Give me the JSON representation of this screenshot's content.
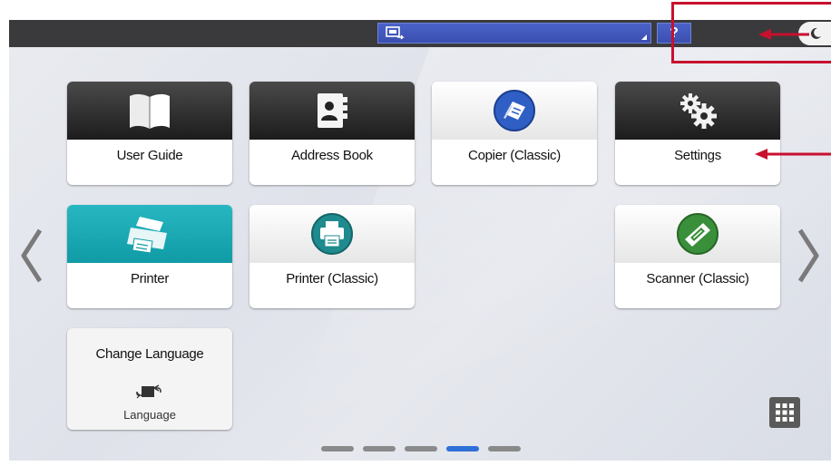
{
  "top_bar": {
    "help_label": "?"
  },
  "tiles": [
    {
      "label": "User Guide",
      "icon": "book-icon"
    },
    {
      "label": "Address Book",
      "icon": "address-book-icon"
    },
    {
      "label": "Copier (Classic)",
      "icon": "copier-icon"
    },
    {
      "label": "Settings",
      "icon": "gears-icon"
    },
    {
      "label": "Printer",
      "icon": "printer-icon"
    },
    {
      "label": "Printer (Classic)",
      "icon": "printer-classic-icon"
    },
    {
      "label": "Scanner (Classic)",
      "icon": "scanner-icon"
    }
  ],
  "language_tile": {
    "title": "Change Language",
    "subtitle": "Language",
    "icon": "language-switch-icon"
  },
  "pagination": {
    "total_pages": 5,
    "current_page": 4
  },
  "colors": {
    "top_bar": "#3a3a3c",
    "status_blue": "#3b4fb0",
    "printer_teal": "#109ba6",
    "copier_blue": "#2f5fc4",
    "scanner_green": "#3a8f3a",
    "annotation_red": "#c8102e",
    "page_dot_active": "#2f6fd8"
  }
}
